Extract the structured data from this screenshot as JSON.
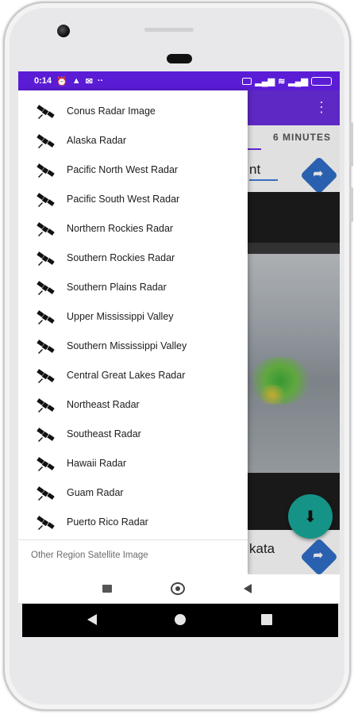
{
  "status_bar": {
    "time": "0:14"
  },
  "background_app": {
    "tab_label": "6 MINUTES",
    "card_title_fragment": "nt",
    "card2_title_fragment": "kata"
  },
  "drawer": {
    "items": [
      {
        "label": "Conus Radar Image",
        "icon": "satellite-icon"
      },
      {
        "label": "Alaska Radar",
        "icon": "satellite-icon"
      },
      {
        "label": "Pacific North West Radar",
        "icon": "satellite-icon"
      },
      {
        "label": "Pacific South West Radar",
        "icon": "satellite-icon"
      },
      {
        "label": "Northern Rockies Radar",
        "icon": "satellite-icon"
      },
      {
        "label": "Southern Rockies Radar",
        "icon": "satellite-icon"
      },
      {
        "label": "Southern Plains Radar",
        "icon": "satellite-icon"
      },
      {
        "label": "Upper Mississippi Valley",
        "icon": "satellite-icon"
      },
      {
        "label": "Southern Mississippi Valley",
        "icon": "satellite-icon"
      },
      {
        "label": "Central Great Lakes Radar",
        "icon": "satellite-icon"
      },
      {
        "label": "Northeast Radar",
        "icon": "satellite-icon"
      },
      {
        "label": "Southeast Radar",
        "icon": "satellite-icon"
      },
      {
        "label": "Hawaii Radar",
        "icon": "satellite-icon"
      },
      {
        "label": "Guam Radar",
        "icon": "satellite-icon"
      },
      {
        "label": "Puerto Rico Radar",
        "icon": "satellite-icon"
      }
    ],
    "section_label": "Other Region Satellite Image"
  },
  "colors": {
    "status_bar": "#5b1cd6",
    "app_bar": "#6a2ee0",
    "fab": "#1aa89a",
    "direction_button": "#2f6fc9"
  }
}
